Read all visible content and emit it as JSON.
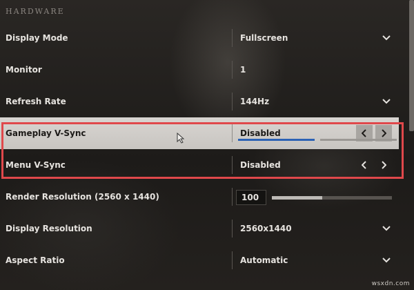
{
  "section": {
    "title": "HARDWARE"
  },
  "rows": [
    {
      "label": "Display Mode",
      "value": "Fullscreen"
    },
    {
      "label": "Monitor",
      "value": "1"
    },
    {
      "label": "Refresh Rate",
      "value": "144Hz"
    },
    {
      "label": "Gameplay V-Sync",
      "value": "Disabled"
    },
    {
      "label": "Menu V-Sync",
      "value": "Disabled"
    },
    {
      "label": "Render Resolution (2560 x 1440)",
      "value": "100",
      "slider_fraction": 0.42
    },
    {
      "label": "Display Resolution",
      "value": "2560x1440"
    },
    {
      "label": "Aspect Ratio",
      "value": "Automatic"
    }
  ],
  "icons": {
    "chevron": "chevron-down-icon",
    "prev": "chevron-left-icon",
    "next": "chevron-right-icon",
    "cursor": "mouse-cursor-icon"
  },
  "gameplay_vsync_option_index": 1,
  "gameplay_vsync_option_count": 2,
  "colors": {
    "highlight": "#e0484b",
    "accent": "#2b62b5"
  },
  "watermark": "wsxdn.com"
}
